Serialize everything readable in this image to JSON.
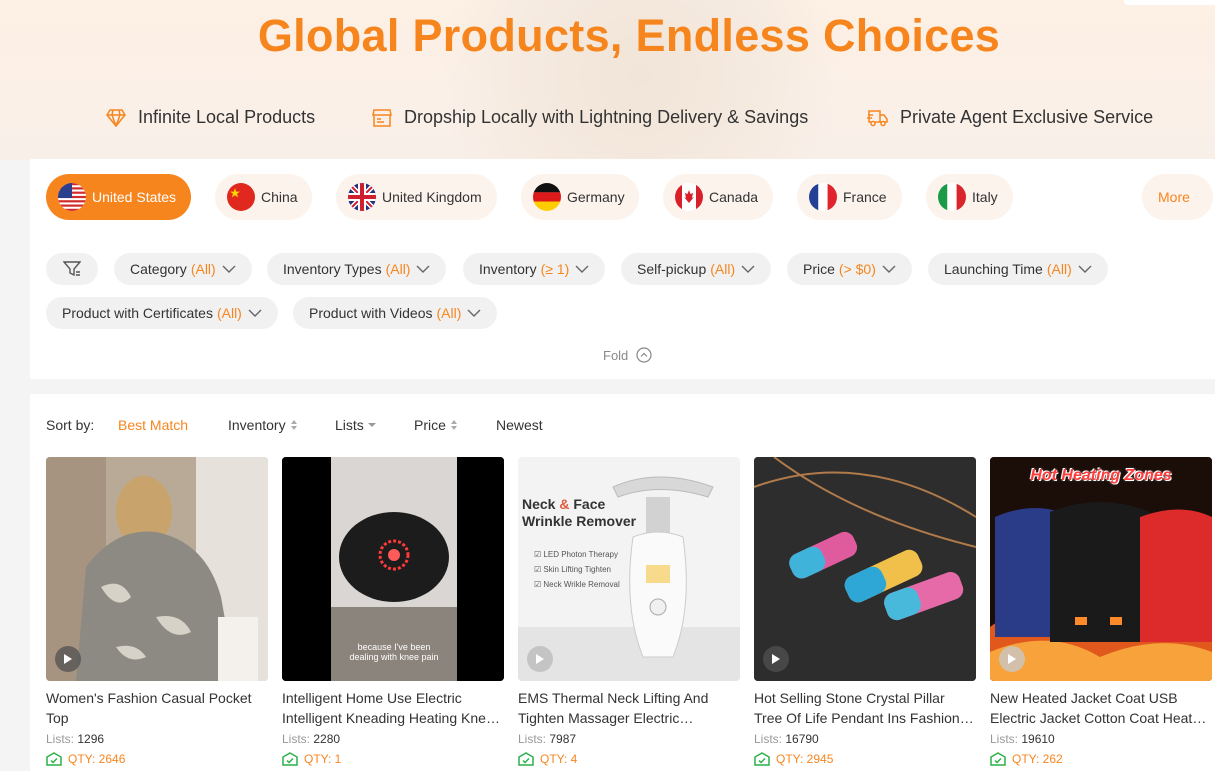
{
  "hero": {
    "title": "Global Products, Endless Choices",
    "features": [
      "Infinite Local Products",
      "Dropship Locally with Lightning Delivery & Savings",
      "Private Agent Exclusive Service"
    ]
  },
  "countries": [
    {
      "label": "United States",
      "icon": "us-flag-icon",
      "active": true
    },
    {
      "label": "China",
      "icon": "china-flag-icon"
    },
    {
      "label": "United Kingdom",
      "icon": "uk-flag-icon"
    },
    {
      "label": "Germany",
      "icon": "germany-flag-icon"
    },
    {
      "label": "Canada",
      "icon": "canada-flag-icon"
    },
    {
      "label": "France",
      "icon": "france-flag-icon"
    },
    {
      "label": "Italy",
      "icon": "italy-flag-icon"
    },
    {
      "label": "More",
      "icon": "chevron-right-icon"
    }
  ],
  "filters": [
    {
      "label": "Category",
      "value": "(All)"
    },
    {
      "label": "Inventory Types",
      "value": "(All)"
    },
    {
      "label": "Inventory",
      "value": "(≥ 1)"
    },
    {
      "label": "Self-pickup",
      "value": "(All)"
    },
    {
      "label": "Price",
      "value": "(> $0)"
    },
    {
      "label": "Launching Time",
      "value": "(All)"
    },
    {
      "label": "Product with Certificates",
      "value": "(All)"
    },
    {
      "label": "Product with Videos",
      "value": "(All)"
    }
  ],
  "fold_label": "Fold",
  "sort": {
    "label": "Sort by:",
    "options": [
      "Best Match",
      "Inventory",
      "Lists",
      "Price",
      "Newest"
    ],
    "active": "Best Match"
  },
  "products": [
    {
      "title": "Women's Fashion Casual Pocket Top",
      "lists_label": "Lists:",
      "lists": "1296",
      "qty": "QTY: 2646"
    },
    {
      "title": "Intelligent Home Use Electric Intelligent Kneading Heating Knee Massager",
      "lists_label": "Lists:",
      "lists": "2280",
      "qty": "QTY: 1",
      "caption": "because I've been dealing with knee pain"
    },
    {
      "title": "EMS Thermal Neck Lifting And Tighten Massager Electric Microcurrent Wrinkle Remover",
      "lists_label": "Lists:",
      "lists": "7987",
      "qty": "QTY: 4",
      "image_text": {
        "headline_1": "Neck",
        "amp": "&",
        "headline_2": "Face",
        "headline_3": "Wrinkle Remover",
        "bullets": [
          "LED Photon Therapy",
          "Skin Lifting Tighten",
          "Neck Wrikle Removal"
        ]
      }
    },
    {
      "title": "Hot Selling Stone Crystal Pillar Tree Of Life Pendant Ins Fashion Necklace",
      "lists_label": "Lists:",
      "lists": "16790",
      "qty": "QTY: 2945"
    },
    {
      "title": "New Heated Jacket Coat USB Electric Jacket Cotton Coat Heater Thermal Clothing",
      "lists_label": "Lists:",
      "lists": "19610",
      "qty": "QTY: 262",
      "image_text": {
        "banner": "Hot Heating Zones"
      }
    }
  ],
  "colors": {
    "accent": "#f7851e",
    "pill_bg": "#f1f1f1",
    "country_bg": "#fcf3ec"
  }
}
